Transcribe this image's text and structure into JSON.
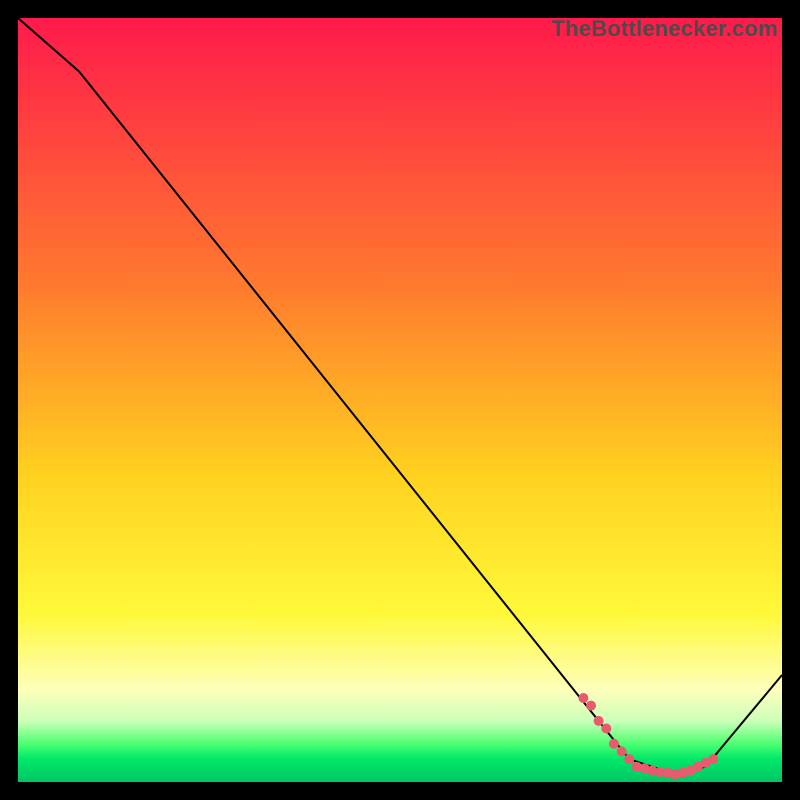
{
  "watermark": {
    "text": "TheBottlenecker.com"
  },
  "chart_data": {
    "type": "line",
    "title": "",
    "xlabel": "",
    "ylabel": "",
    "xlim": [
      0,
      100
    ],
    "ylim": [
      0,
      100
    ],
    "background_gradient": {
      "stops": [
        {
          "offset": 0,
          "color": "#ff1a4b"
        },
        {
          "offset": 0.35,
          "color": "#ff7a2e"
        },
        {
          "offset": 0.6,
          "color": "#ffd21f"
        },
        {
          "offset": 0.78,
          "color": "#fff93a"
        },
        {
          "offset": 0.88,
          "color": "#fdffbb"
        },
        {
          "offset": 0.92,
          "color": "#ccffb8"
        },
        {
          "offset": 0.95,
          "color": "#4dff72"
        },
        {
          "offset": 0.97,
          "color": "#00e868"
        },
        {
          "offset": 1.0,
          "color": "#00c765"
        }
      ]
    },
    "series": [
      {
        "name": "bottleneck-curve",
        "x": [
          0,
          8,
          80,
          86,
          90,
          100
        ],
        "values": [
          100,
          93,
          3,
          1,
          2,
          14
        ]
      }
    ],
    "markers": {
      "name": "highlight-dots",
      "color": "#e85a6e",
      "x": [
        74,
        75,
        76,
        77,
        78,
        79,
        80,
        81,
        82,
        83,
        84,
        85,
        86,
        87,
        88,
        89,
        90,
        91
      ],
      "values": [
        11,
        10,
        8,
        7,
        5,
        4,
        3,
        2,
        1.8,
        1.5,
        1.3,
        1.2,
        1.0,
        1.2,
        1.5,
        2.0,
        2.5,
        3.0
      ]
    }
  }
}
